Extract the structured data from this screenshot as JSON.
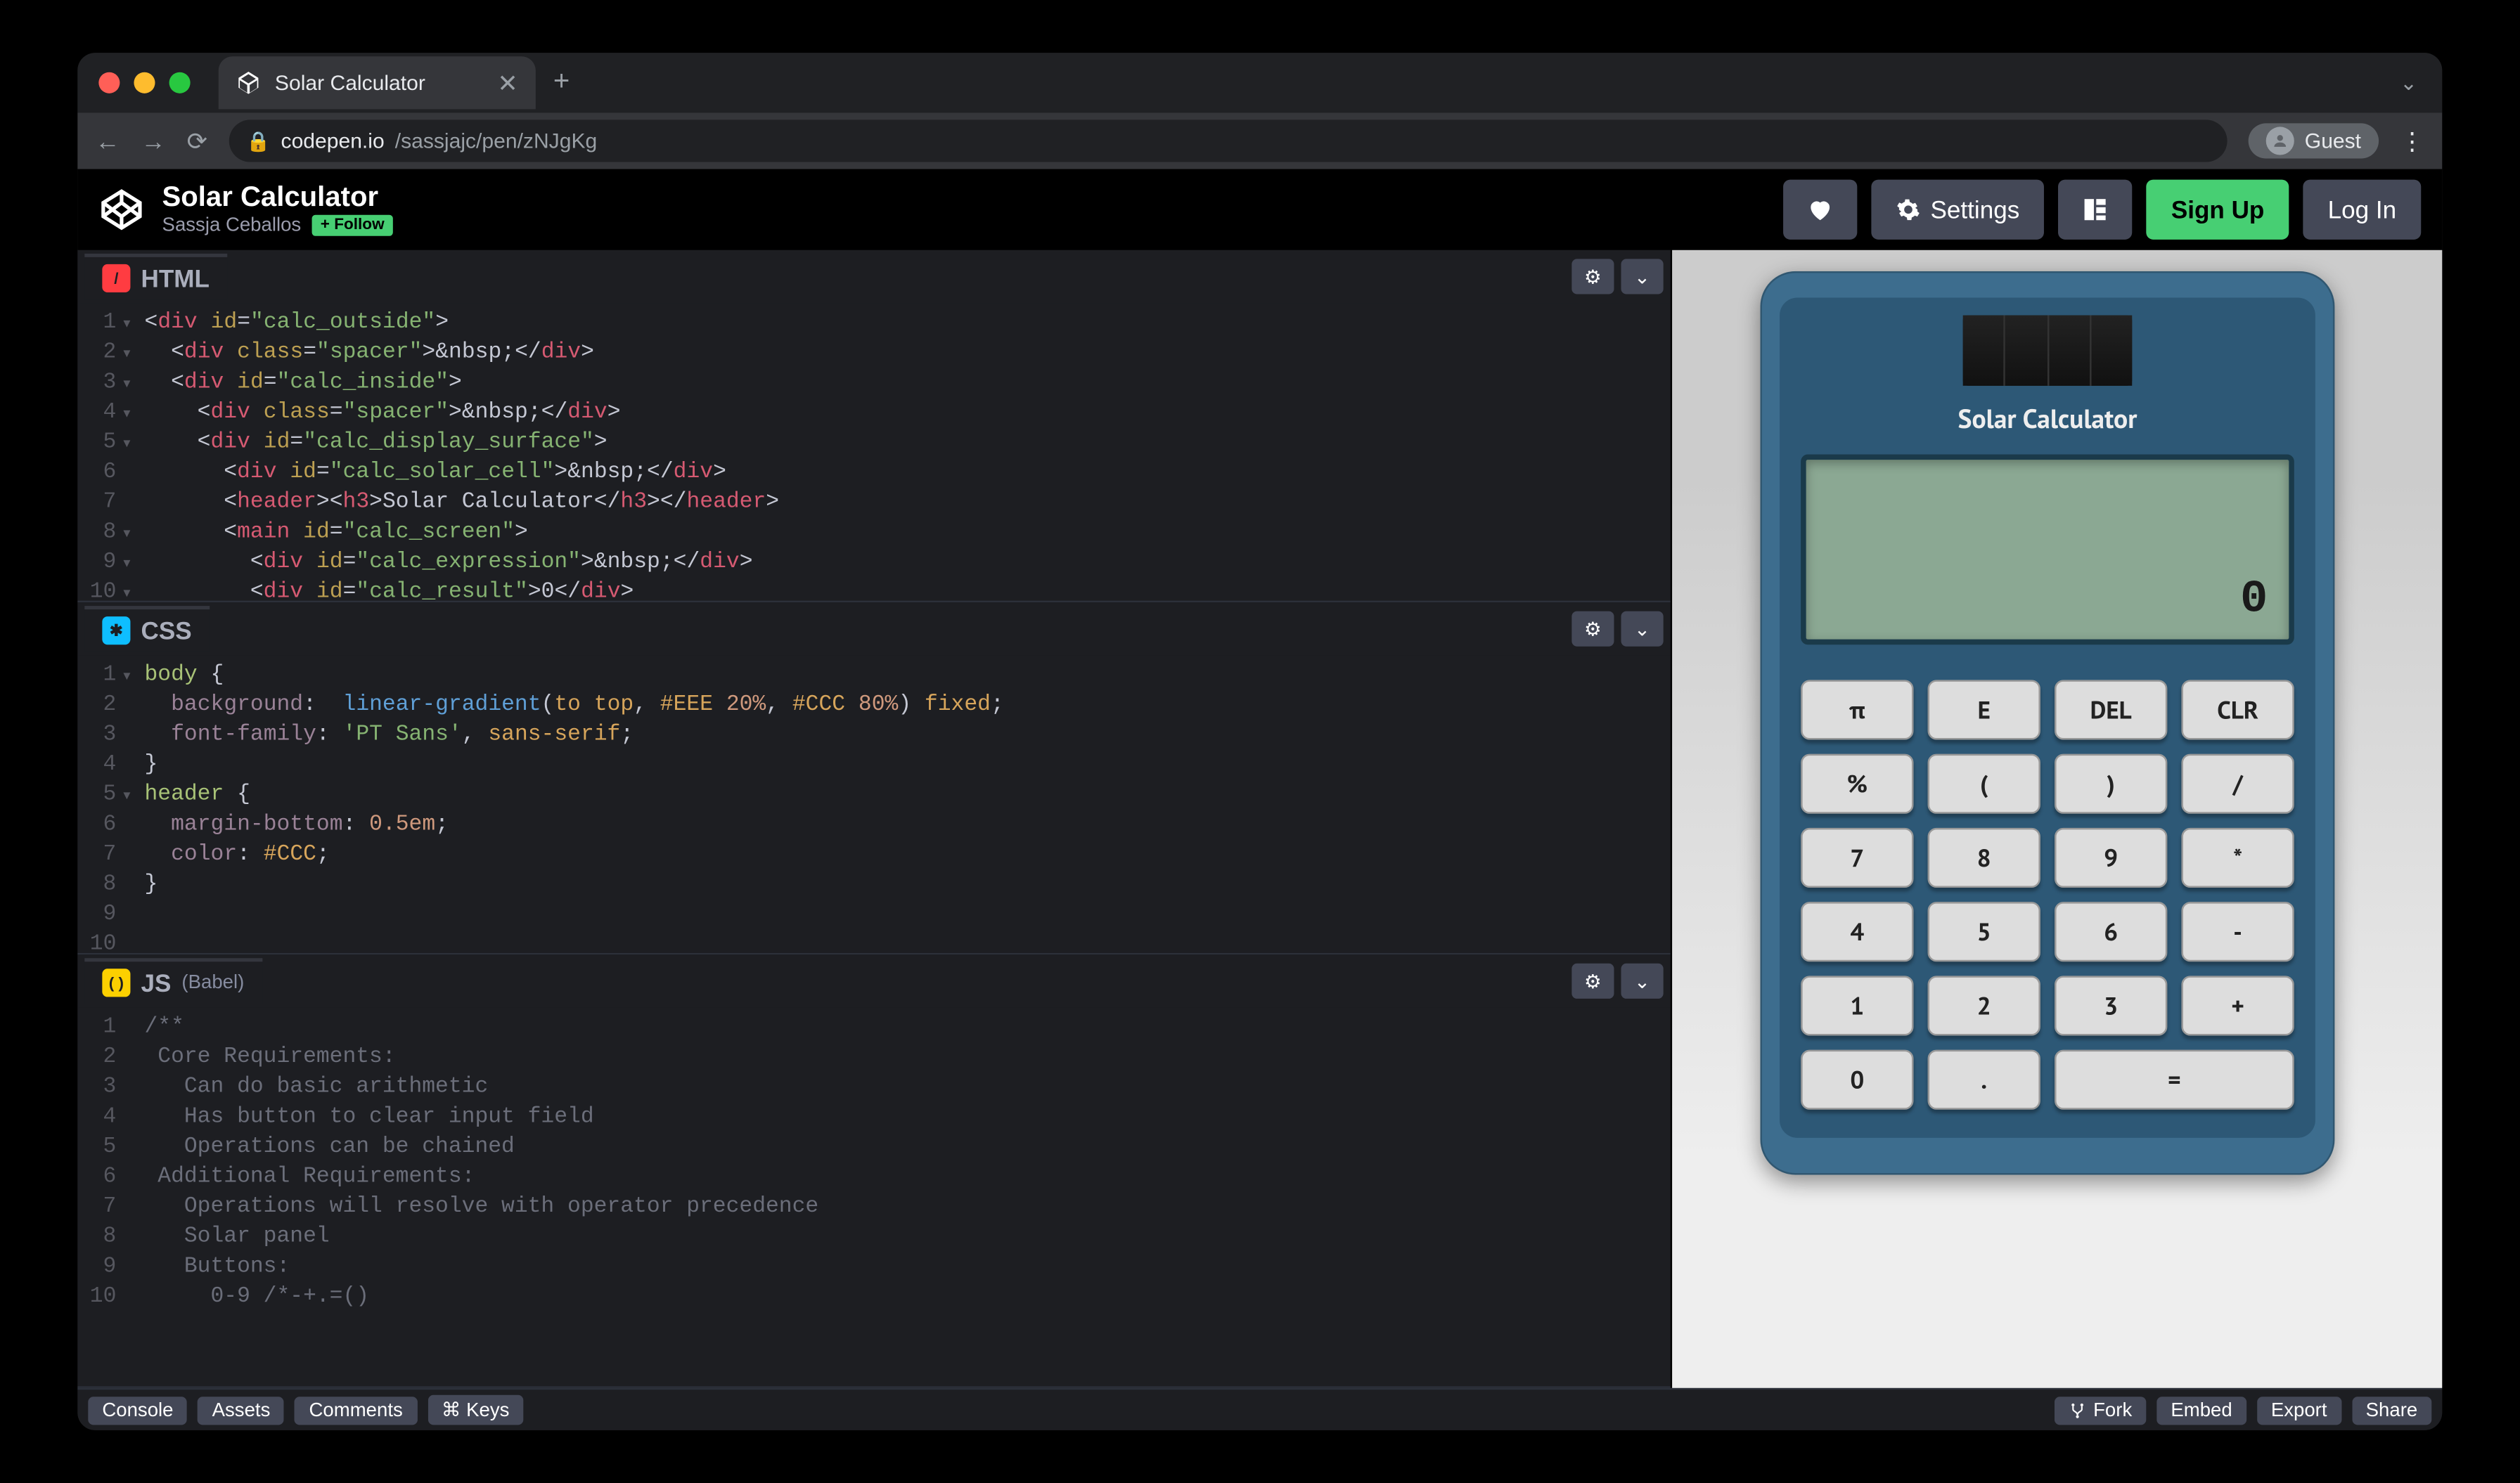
{
  "browser": {
    "tab_title": "Solar Calculator",
    "url_host": "codepen.io",
    "url_path": "/sassjajc/pen/zNJgKg",
    "guest_label": "Guest"
  },
  "header": {
    "title": "Solar Calculator",
    "author": "Sassja Ceballos",
    "follow_label": "+ Follow",
    "settings_label": "Settings",
    "signup_label": "Sign Up",
    "login_label": "Log In"
  },
  "panels": {
    "html": {
      "label": "HTML"
    },
    "css": {
      "label": "CSS"
    },
    "js": {
      "label": "JS",
      "sub": "(Babel)"
    }
  },
  "code": {
    "html": [
      {
        "n": "1",
        "fold": true,
        "seg": [
          [
            "t-punct",
            "<"
          ],
          [
            "t-tag",
            "div"
          ],
          [
            "t-punct",
            " "
          ],
          [
            "t-attr",
            "id"
          ],
          [
            "t-punct",
            "="
          ],
          [
            "t-str",
            "\"calc_outside\""
          ],
          [
            "t-punct",
            ">"
          ]
        ]
      },
      {
        "n": "2",
        "fold": true,
        "seg": [
          [
            "t-punct",
            "  <"
          ],
          [
            "t-tag",
            "div"
          ],
          [
            "t-punct",
            " "
          ],
          [
            "t-attr",
            "class"
          ],
          [
            "t-punct",
            "="
          ],
          [
            "t-str",
            "\"spacer\""
          ],
          [
            "t-punct",
            ">"
          ],
          [
            "t-kw",
            "&nbsp;"
          ],
          [
            "t-punct",
            "</"
          ],
          [
            "t-tag",
            "div"
          ],
          [
            "t-punct",
            ">"
          ]
        ]
      },
      {
        "n": "3",
        "fold": true,
        "seg": [
          [
            "t-punct",
            "  <"
          ],
          [
            "t-tag",
            "div"
          ],
          [
            "t-punct",
            " "
          ],
          [
            "t-attr",
            "id"
          ],
          [
            "t-punct",
            "="
          ],
          [
            "t-str",
            "\"calc_inside\""
          ],
          [
            "t-punct",
            ">"
          ]
        ]
      },
      {
        "n": "4",
        "fold": true,
        "seg": [
          [
            "t-punct",
            "    <"
          ],
          [
            "t-tag",
            "div"
          ],
          [
            "t-punct",
            " "
          ],
          [
            "t-attr",
            "class"
          ],
          [
            "t-punct",
            "="
          ],
          [
            "t-str",
            "\"spacer\""
          ],
          [
            "t-punct",
            ">"
          ],
          [
            "t-kw",
            "&nbsp;"
          ],
          [
            "t-punct",
            "</"
          ],
          [
            "t-tag",
            "div"
          ],
          [
            "t-punct",
            ">"
          ]
        ]
      },
      {
        "n": "5",
        "fold": true,
        "seg": [
          [
            "t-punct",
            "    <"
          ],
          [
            "t-tag",
            "div"
          ],
          [
            "t-punct",
            " "
          ],
          [
            "t-attr",
            "id"
          ],
          [
            "t-punct",
            "="
          ],
          [
            "t-str",
            "\"calc_display_surface\""
          ],
          [
            "t-punct",
            ">"
          ]
        ]
      },
      {
        "n": "6",
        "fold": false,
        "seg": [
          [
            "t-punct",
            "      <"
          ],
          [
            "t-tag",
            "div"
          ],
          [
            "t-punct",
            " "
          ],
          [
            "t-attr",
            "id"
          ],
          [
            "t-punct",
            "="
          ],
          [
            "t-str",
            "\"calc_solar_cell\""
          ],
          [
            "t-punct",
            ">"
          ],
          [
            "t-kw",
            "&nbsp;"
          ],
          [
            "t-punct",
            "</"
          ],
          [
            "t-tag",
            "div"
          ],
          [
            "t-punct",
            ">"
          ]
        ]
      },
      {
        "n": "7",
        "fold": false,
        "seg": [
          [
            "t-punct",
            "      <"
          ],
          [
            "t-tag",
            "header"
          ],
          [
            "t-punct",
            "><"
          ],
          [
            "t-tag",
            "h3"
          ],
          [
            "t-punct",
            ">"
          ],
          [
            "t-kw",
            "Solar Calculator"
          ],
          [
            "t-punct",
            "</"
          ],
          [
            "t-tag",
            "h3"
          ],
          [
            "t-punct",
            "></"
          ],
          [
            "t-tag",
            "header"
          ],
          [
            "t-punct",
            ">"
          ]
        ]
      },
      {
        "n": "8",
        "fold": true,
        "seg": [
          [
            "t-punct",
            "      <"
          ],
          [
            "t-tag",
            "main"
          ],
          [
            "t-punct",
            " "
          ],
          [
            "t-attr",
            "id"
          ],
          [
            "t-punct",
            "="
          ],
          [
            "t-str",
            "\"calc_screen\""
          ],
          [
            "t-punct",
            ">"
          ]
        ]
      },
      {
        "n": "9",
        "fold": true,
        "seg": [
          [
            "t-punct",
            "        <"
          ],
          [
            "t-tag",
            "div"
          ],
          [
            "t-punct",
            " "
          ],
          [
            "t-attr",
            "id"
          ],
          [
            "t-punct",
            "="
          ],
          [
            "t-str",
            "\"calc_expression\""
          ],
          [
            "t-punct",
            ">"
          ],
          [
            "t-kw",
            "&nbsp;"
          ],
          [
            "t-punct",
            "</"
          ],
          [
            "t-tag",
            "div"
          ],
          [
            "t-punct",
            ">"
          ]
        ]
      },
      {
        "n": "10",
        "fold": true,
        "seg": [
          [
            "t-punct",
            "        <"
          ],
          [
            "t-tag",
            "div"
          ],
          [
            "t-punct",
            " "
          ],
          [
            "t-attr",
            "id"
          ],
          [
            "t-punct",
            "="
          ],
          [
            "t-str",
            "\"calc_result\""
          ],
          [
            "t-punct",
            ">"
          ],
          [
            "t-kw",
            "0"
          ],
          [
            "t-punct",
            "</"
          ],
          [
            "t-tag",
            "div"
          ],
          [
            "t-punct",
            ">"
          ]
        ]
      }
    ],
    "css": [
      {
        "n": "1",
        "fold": true,
        "seg": [
          [
            "t-sel",
            "body "
          ],
          [
            "t-punct",
            "{"
          ]
        ]
      },
      {
        "n": "2",
        "seg": [
          [
            "t-punct",
            "  "
          ],
          [
            "t-prop",
            "background"
          ],
          [
            "t-punct",
            ":  "
          ],
          [
            "t-fn",
            "linear-gradient"
          ],
          [
            "t-punct",
            "("
          ],
          [
            "t-val",
            "to top"
          ],
          [
            "t-punct",
            ", "
          ],
          [
            "t-val",
            "#EEE "
          ],
          [
            "t-num",
            "20%"
          ],
          [
            "t-punct",
            ", "
          ],
          [
            "t-val",
            "#CCC "
          ],
          [
            "t-num",
            "80%"
          ],
          [
            "t-punct",
            ") "
          ],
          [
            "t-val",
            "fixed"
          ],
          [
            "t-punct",
            ";"
          ]
        ]
      },
      {
        "n": "3",
        "seg": [
          [
            "t-punct",
            "  "
          ],
          [
            "t-prop",
            "font-family"
          ],
          [
            "t-punct",
            ": "
          ],
          [
            "t-str",
            "'PT Sans'"
          ],
          [
            "t-punct",
            ", "
          ],
          [
            "t-val",
            "sans-serif"
          ],
          [
            "t-punct",
            ";"
          ]
        ]
      },
      {
        "n": "4",
        "seg": [
          [
            "t-punct",
            "}"
          ]
        ]
      },
      {
        "n": "5",
        "fold": true,
        "seg": [
          [
            "t-sel",
            "header "
          ],
          [
            "t-punct",
            "{"
          ]
        ]
      },
      {
        "n": "6",
        "seg": [
          [
            "t-punct",
            "  "
          ],
          [
            "t-prop",
            "margin-bottom"
          ],
          [
            "t-punct",
            ": "
          ],
          [
            "t-num",
            "0.5em"
          ],
          [
            "t-punct",
            ";"
          ]
        ]
      },
      {
        "n": "7",
        "seg": [
          [
            "t-punct",
            "  "
          ],
          [
            "t-prop",
            "color"
          ],
          [
            "t-punct",
            ": "
          ],
          [
            "t-val",
            "#CCC"
          ],
          [
            "t-punct",
            ";"
          ]
        ]
      },
      {
        "n": "8",
        "seg": [
          [
            "t-punct",
            "}"
          ]
        ]
      },
      {
        "n": "9",
        "seg": [
          [
            "",
            ""
          ]
        ]
      },
      {
        "n": "10",
        "seg": [
          [
            "",
            ""
          ]
        ]
      }
    ],
    "js": [
      {
        "n": "1",
        "seg": [
          [
            "t-comment",
            "/**"
          ]
        ]
      },
      {
        "n": "2",
        "seg": [
          [
            "t-comment",
            " Core Requirements:"
          ]
        ]
      },
      {
        "n": "3",
        "seg": [
          [
            "t-comment",
            "   Can do basic arithmetic"
          ]
        ]
      },
      {
        "n": "4",
        "seg": [
          [
            "t-comment",
            "   Has button to clear input field"
          ]
        ]
      },
      {
        "n": "5",
        "seg": [
          [
            "t-comment",
            "   Operations can be chained"
          ]
        ]
      },
      {
        "n": "6",
        "seg": [
          [
            "t-comment",
            " Additional Requirements:"
          ]
        ]
      },
      {
        "n": "7",
        "seg": [
          [
            "t-comment",
            "   Operations will resolve with operator precedence"
          ]
        ]
      },
      {
        "n": "8",
        "seg": [
          [
            "t-comment",
            "   Solar panel"
          ]
        ]
      },
      {
        "n": "9",
        "seg": [
          [
            "t-comment",
            "   Buttons:"
          ]
        ]
      },
      {
        "n": "10",
        "seg": [
          [
            "t-comment",
            "     0-9 /*-+.=()"
          ]
        ]
      }
    ]
  },
  "footer": {
    "console": "Console",
    "assets": "Assets",
    "comments": "Comments",
    "keys": "⌘ Keys",
    "fork": "Fork",
    "embed": "Embed",
    "export": "Export",
    "share": "Share"
  },
  "preview": {
    "calculator_title": "Solar Calculator",
    "result": "0",
    "buttons": [
      "π",
      "E",
      "DEL",
      "CLR",
      "%",
      "(",
      ")",
      "/",
      "7",
      "8",
      "9",
      "*",
      "4",
      "5",
      "6",
      "-",
      "1",
      "2",
      "3",
      "+",
      "0",
      ".",
      "="
    ]
  }
}
